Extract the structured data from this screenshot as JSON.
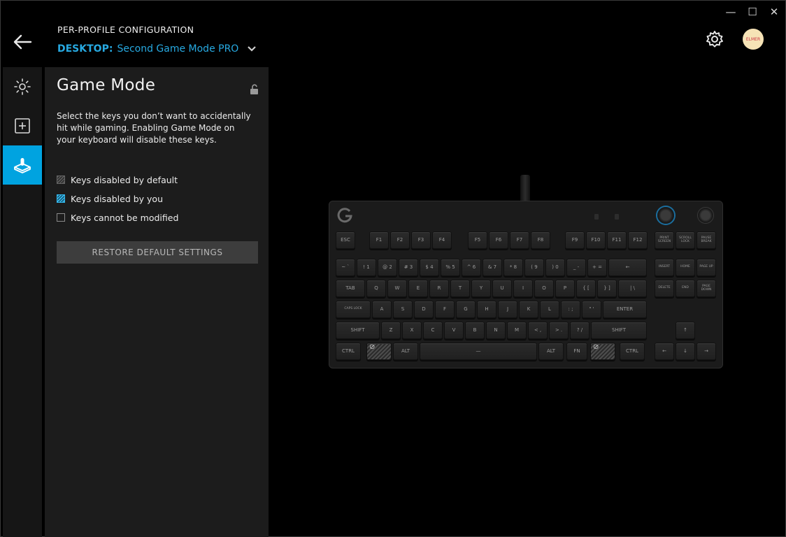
{
  "window": {
    "minimize": "—",
    "maximize": "☐",
    "close": "✕"
  },
  "header": {
    "title": "PER-PROFILE CONFIGURATION",
    "profile_kind": "DESKTOP:",
    "profile_name": "Second Game Mode PRO",
    "avatar_text": "ELMER"
  },
  "rail": [
    {
      "name": "lighting",
      "icon": "sun-icon",
      "active": false
    },
    {
      "name": "assignments",
      "icon": "plus-square-icon",
      "active": false
    },
    {
      "name": "game-mode",
      "icon": "joystick-icon",
      "active": true
    }
  ],
  "panel": {
    "title": "Game Mode",
    "description": "Select the keys you don’t want to accidentally hit while gaming. Enabling Game Mode on your keyboard will disable these keys.",
    "legend": {
      "default": "Keys disabled by default",
      "you": "Keys disabled by you",
      "none": "Keys cannot be modified"
    },
    "restore_label": "RESTORE DEFAULT SETTINGS"
  },
  "keyboard": {
    "accent": "#27a9e1",
    "rows": [
      [
        "ESC",
        "F1",
        "F2",
        "F3",
        "F4",
        "F5",
        "F6",
        "F7",
        "F8",
        "F9",
        "F10",
        "F11",
        "F12",
        "PRINT SCREEN",
        "SCROLL LOCK",
        "PAUSE BREAK"
      ],
      [
        "~ `",
        "! 1",
        "@ 2",
        "# 3",
        "$ 4",
        "% 5",
        "^ 6",
        "& 7",
        "* 8",
        "( 9",
        ") 0",
        "_ -",
        "+ =",
        "←",
        "INSERT",
        "HOME",
        "PAGE UP"
      ],
      [
        "TAB",
        "Q",
        "W",
        "E",
        "R",
        "T",
        "Y",
        "U",
        "I",
        "O",
        "P",
        "{ [",
        "} ]",
        "| \\",
        "DELETE",
        "END",
        "PAGE DOWN"
      ],
      [
        "CAPS LOCK",
        "A",
        "S",
        "D",
        "F",
        "G",
        "H",
        "J",
        "K",
        "L",
        ": ;",
        "\" '",
        "ENTER"
      ],
      [
        "SHIFT",
        "Z",
        "X",
        "C",
        "V",
        "B",
        "N",
        "M",
        "< ,",
        "> .",
        "? /",
        "SHIFT",
        "↑"
      ],
      [
        "CTRL",
        "",
        "ALT",
        "—",
        "ALT",
        "FN",
        "",
        "CTRL",
        "←",
        "↓",
        "→"
      ]
    ]
  }
}
